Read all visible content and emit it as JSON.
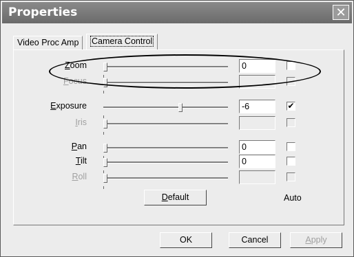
{
  "window": {
    "title": "Properties",
    "close_glyph": "✕"
  },
  "tabs": [
    {
      "label": "Video Proc Amp",
      "active": false
    },
    {
      "label": "Camera Control",
      "active": true
    }
  ],
  "controls": [
    {
      "name": "zoom",
      "label": "Zoom",
      "accel": "Z",
      "rest": "oom",
      "enabled": true,
      "value": "0",
      "auto_enabled": true,
      "auto_checked": false,
      "slider": 0.0
    },
    {
      "name": "focus",
      "label": "Focus",
      "accel": "F",
      "rest": "ocus",
      "enabled": false,
      "value": "",
      "auto_enabled": false,
      "auto_checked": false,
      "slider": 0.0
    },
    {
      "name": "exposure",
      "label": "Exposure",
      "accel": "E",
      "rest": "xposure",
      "enabled": true,
      "value": "-6",
      "auto_enabled": true,
      "auto_checked": true,
      "slider": 0.62
    },
    {
      "name": "iris",
      "label": "Iris",
      "accel": "I",
      "rest": "ris",
      "enabled": false,
      "value": "",
      "auto_enabled": false,
      "auto_checked": false,
      "slider": 0.0
    },
    {
      "name": "pan",
      "label": "Pan",
      "accel": "P",
      "rest": "an",
      "enabled": true,
      "value": "0",
      "auto_enabled": true,
      "auto_checked": false,
      "slider": 0.0
    },
    {
      "name": "tilt",
      "label": "Tilt",
      "accel": "T",
      "rest": "ilt",
      "enabled": true,
      "value": "0",
      "auto_enabled": true,
      "auto_checked": false,
      "slider": 0.0
    },
    {
      "name": "roll",
      "label": "Roll",
      "accel": "R",
      "rest": "oll",
      "enabled": false,
      "value": "",
      "auto_enabled": false,
      "auto_checked": false,
      "slider": 0.0
    }
  ],
  "default_button": {
    "accel": "D",
    "rest": "efault"
  },
  "auto_label": "Auto",
  "buttons": {
    "ok": "OK",
    "cancel": "Cancel",
    "apply_accel": "A",
    "apply_rest": "pply"
  }
}
